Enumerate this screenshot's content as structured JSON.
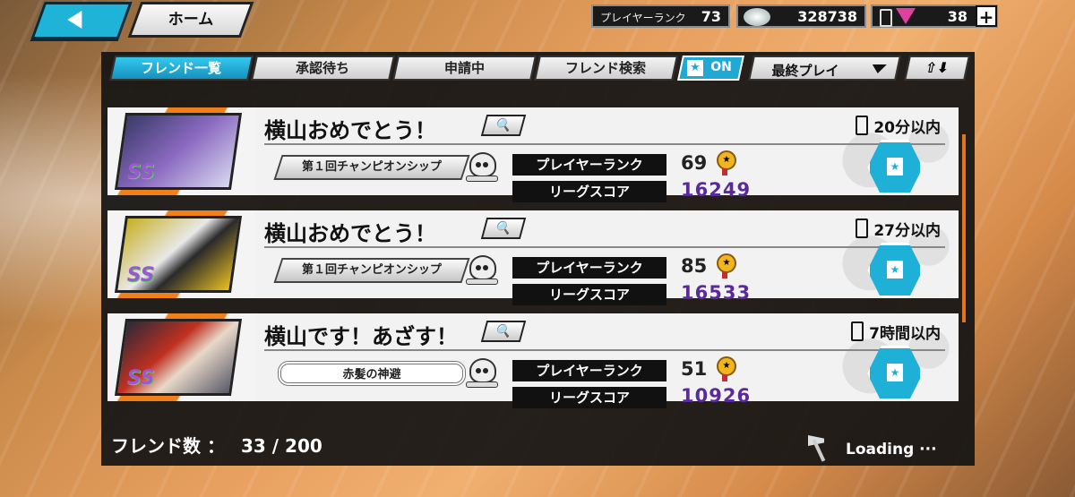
{
  "header": {
    "home_label": "ホーム",
    "player_rank_label": "プレイヤーランク",
    "player_rank_value": "73",
    "coins": "328738",
    "gems": "38",
    "plus": "+"
  },
  "tabs": [
    {
      "label": "フレンド一覧",
      "active": true
    },
    {
      "label": "承認待ち",
      "active": false
    },
    {
      "label": "申請中",
      "active": false
    },
    {
      "label": "フレンド検索",
      "active": false
    }
  ],
  "filter": {
    "fav_toggle": "ON",
    "sort_label": "最終プレイ",
    "order_label": "⇧⬇"
  },
  "friends": [
    {
      "name": "横山おめでとう！",
      "time": "20分以内",
      "title": "第１回チャンピオンシップ",
      "rank_label": "プレイヤーランク",
      "rank": "69",
      "league_label": "リーグスコア",
      "league_score": "16249",
      "grade": "SS"
    },
    {
      "name": "横山おめでとう！",
      "time": "27分以内",
      "title": "第１回チャンピオンシップ",
      "rank_label": "プレイヤーランク",
      "rank": "85",
      "league_label": "リーグスコア",
      "league_score": "16533",
      "grade": "SS"
    },
    {
      "name": "横山です！あざす！",
      "time": "7時間以内",
      "title": "赤髪の神避",
      "rank_label": "プレイヤーランク",
      "rank": "51",
      "league_label": "リーグスコア",
      "league_score": "10926",
      "grade": "SS"
    }
  ],
  "footer": {
    "count_label": "フレンド数 ：",
    "count_value": "33 / 200",
    "loading": "Loading ···"
  },
  "colors": {
    "accent": "#1fb3d8",
    "orange": "#f0801c",
    "league": "#5a2a9a"
  }
}
